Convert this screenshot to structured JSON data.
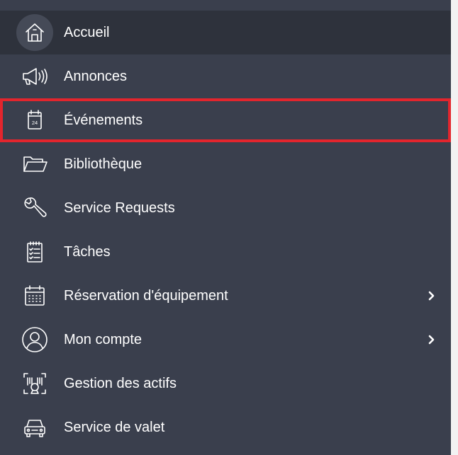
{
  "sidebar": {
    "items": [
      {
        "label": "Accueil",
        "icon": "home-icon"
      },
      {
        "label": "Annonces",
        "icon": "megaphone-icon"
      },
      {
        "label": "Événements",
        "icon": "calendar-icon",
        "calendar_day": "24"
      },
      {
        "label": "Bibliothèque",
        "icon": "folder-icon"
      },
      {
        "label": "Service Requests",
        "icon": "wrench-icon"
      },
      {
        "label": "Tâches",
        "icon": "clipboard-icon"
      },
      {
        "label": "Réservation d'équipement",
        "icon": "calendar-grid-icon"
      },
      {
        "label": "Mon compte",
        "icon": "user-icon"
      },
      {
        "label": "Gestion des actifs",
        "icon": "barcode-scan-icon"
      },
      {
        "label": "Service de valet",
        "icon": "car-icon"
      }
    ]
  },
  "colors": {
    "sidebar_bg": "#3a3f4d",
    "active_bg": "#2e323c",
    "highlight_border": "#e3252d",
    "text": "#ffffff"
  }
}
